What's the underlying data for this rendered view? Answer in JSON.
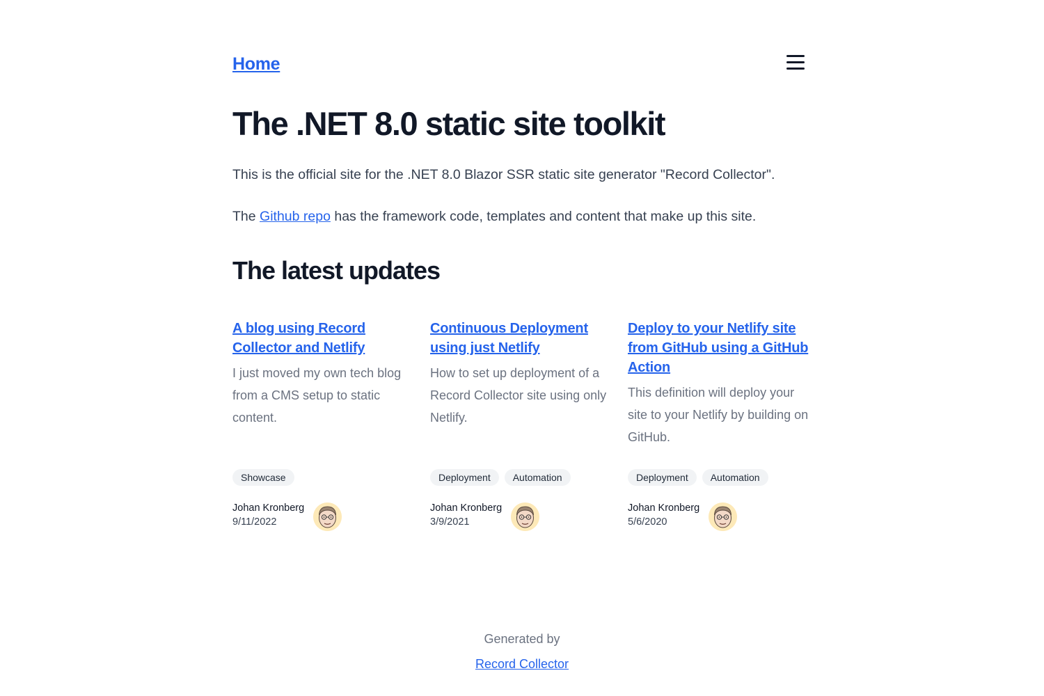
{
  "nav": {
    "home_label": "Home",
    "menu_icon": "hamburger-menu-icon"
  },
  "main": {
    "title": "The .NET 8.0 static site toolkit",
    "intro_1": "This is the official site for the .NET 8.0 Blazor SSR static site generator \"Record Collector\".",
    "intro_2_before": "The ",
    "intro_2_link": "Github repo",
    "intro_2_after": " has the framework code, templates and content that make up this site.",
    "latest_heading": "The latest updates"
  },
  "posts": [
    {
      "title": "A blog using Record Collector and Netlify",
      "description": "I just moved my own tech blog from a CMS setup to static content.",
      "tags": [
        "Showcase"
      ],
      "author": "Johan Kronberg",
      "date": "9/11/2022"
    },
    {
      "title": "Continuous Deployment using just Netlify",
      "description": "How to set up deployment of a Record Collector site using only Netlify.",
      "tags": [
        "Deployment",
        "Automation"
      ],
      "author": "Johan Kronberg",
      "date": "3/9/2021"
    },
    {
      "title": "Deploy to your Netlify site from GitHub using a GitHub Action",
      "description": "This definition will deploy your site to your Netlify by building on GitHub.",
      "tags": [
        "Deployment",
        "Automation"
      ],
      "author": "Johan Kronberg",
      "date": "5/6/2020"
    }
  ],
  "footer": {
    "generated_by": "Generated by",
    "link_label": "Record Collector"
  },
  "colors": {
    "link": "#2563eb",
    "heading": "#111827",
    "muted": "#6b7280",
    "tag_bg": "#f1f3f5",
    "avatar_bg": "#fde9b8"
  }
}
